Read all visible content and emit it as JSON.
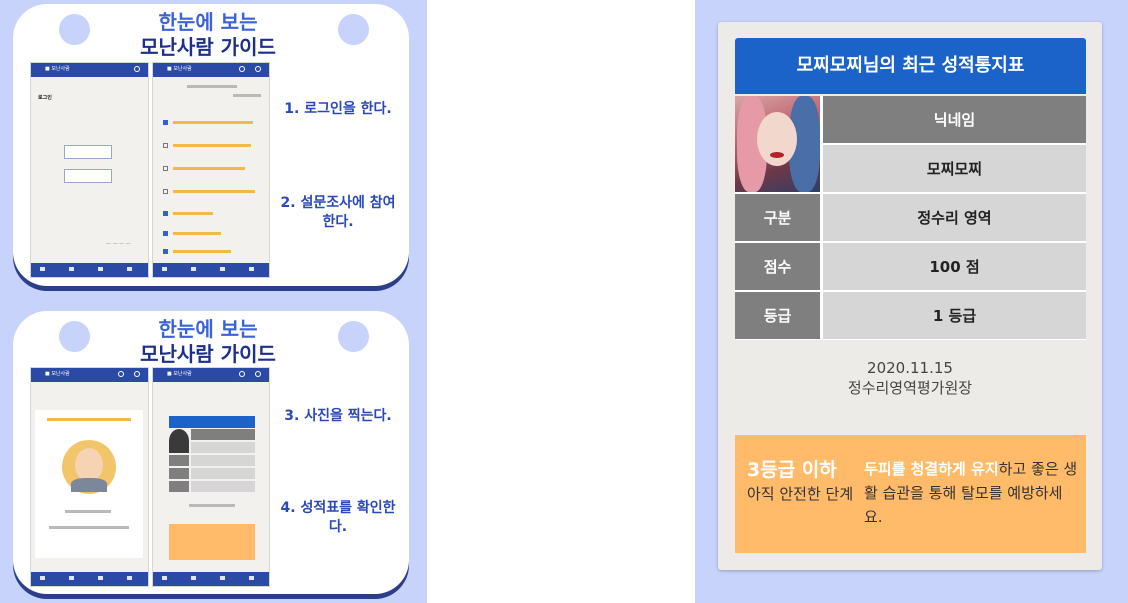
{
  "guide": {
    "title_line1": "한눈에 보는",
    "title_line2": "모난사람 가이드",
    "steps": [
      {
        "text": "1. 로그인을 한다."
      },
      {
        "text": "2. 설문조사에 참여한다."
      },
      {
        "text": "3. 사진을 찍는다."
      },
      {
        "text": "4. 성적표를 확인한다."
      }
    ]
  },
  "report": {
    "title": "모찌모찌님의 최근 성적통지표",
    "nickname_label": "닉네임",
    "nickname_value": "모찌모찌",
    "rows": [
      {
        "label": "구분",
        "value": "정수리 영역"
      },
      {
        "label": "점수",
        "value": "100 점"
      },
      {
        "label": "등급",
        "value": "1 등급"
      }
    ],
    "date": "2020.11.15",
    "issuer": "정수리영역평가원장",
    "note": {
      "grade": "3등급 이하",
      "sub": "아직 안전한 단계",
      "body_highlight": "두피를 청결하게 유지",
      "body_rest": "하고 좋은 생활 습관을 통해 탈모를 예방하세요."
    }
  },
  "colors": {
    "page_bg": "#c7d3fb",
    "header_blue": "#1b63c9",
    "label_grey": "#7f7f7f",
    "value_grey": "#d6d6d6",
    "note_orange": "#ffbb6a"
  }
}
